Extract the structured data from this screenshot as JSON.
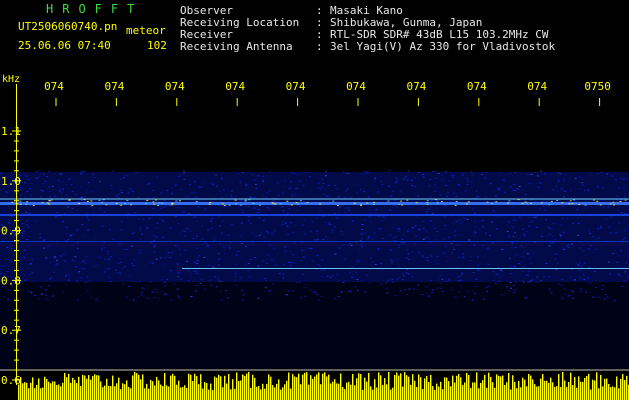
{
  "header": {
    "brand": "HROFFT",
    "filename": "UT2506060740.pn",
    "mode": "meteor",
    "datetime": "25.06.06 07:40",
    "count": "102",
    "info": [
      {
        "label": "Observer",
        "value": "Masaki Kano"
      },
      {
        "label": "Receiving Location",
        "value": "Shibukawa, Gunma, Japan"
      },
      {
        "label": "Receiver",
        "value": "RTL-SDR SDR# 43dB L15 103.2MHz CW"
      },
      {
        "label": "Receiving Antenna",
        "value": "3el Yagi(V) Az 330 for Vladivostok"
      }
    ],
    "separator": ":"
  },
  "axis": {
    "unit": "kHz",
    "yticks": [
      "1.1",
      "1.0",
      "0.9",
      "0.8",
      "0.7",
      "0.6"
    ],
    "xticks": [
      "074",
      "074",
      "074",
      "074",
      "074",
      "074",
      "074",
      "074",
      "074",
      "0750"
    ]
  },
  "colors": {
    "text": "#e8e8e8",
    "labels": "#ffff00",
    "brand": "#3ddc3d",
    "signal": "#0a2cff",
    "echo": "#4ce3ff"
  }
}
